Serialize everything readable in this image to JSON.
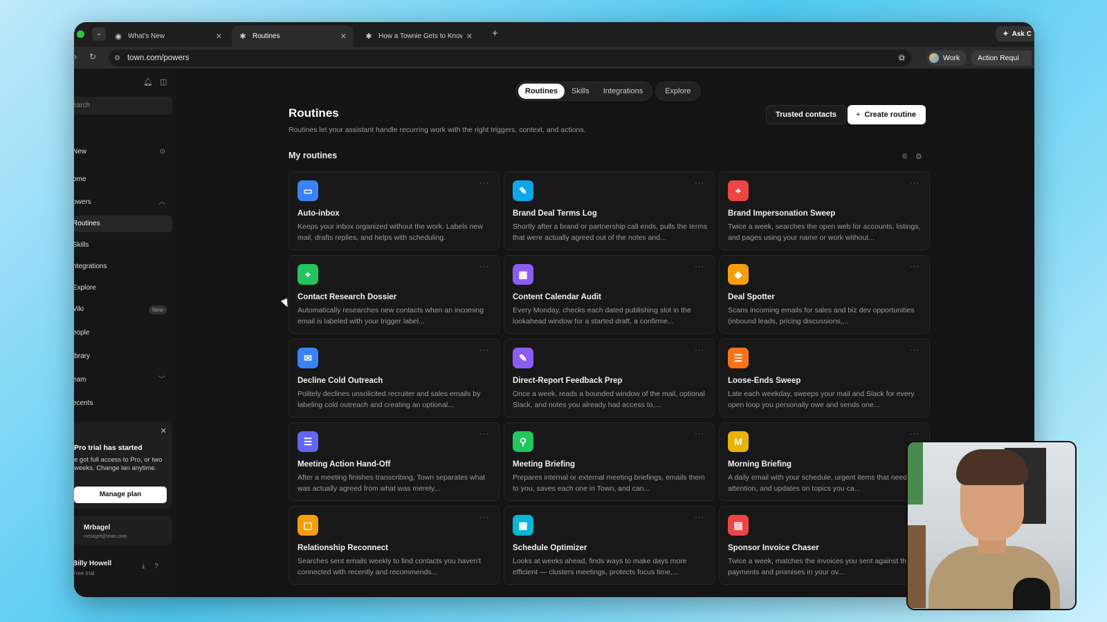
{
  "browser": {
    "tabs": [
      {
        "label": "What's New",
        "icon": "globe-icon"
      },
      {
        "label": "Routines",
        "icon": "asterisk-icon",
        "active": true
      },
      {
        "label": "How a Townie Gets to Know Y",
        "icon": "asterisk-icon"
      }
    ],
    "ask_label": "Ask C",
    "url": "town.com/powers",
    "profile_label": "Work",
    "action_label": "Action Requi"
  },
  "sidebar": {
    "search_placeholder": "earch",
    "items": [
      {
        "label": "New",
        "key": "new"
      },
      {
        "label": "ome",
        "key": "home"
      },
      {
        "label": "owers",
        "key": "powers"
      },
      {
        "label": "Routines",
        "key": "routines"
      },
      {
        "label": "Skills",
        "key": "skills"
      },
      {
        "label": "ntegrations",
        "key": "integrations"
      },
      {
        "label": "Explore",
        "key": "explore"
      },
      {
        "label": "Viki",
        "key": "wiki",
        "badge": "New"
      },
      {
        "label": "eople",
        "key": "people"
      },
      {
        "label": "ibrary",
        "key": "library"
      },
      {
        "label": "eam",
        "key": "team"
      },
      {
        "label": "ecents",
        "key": "recents"
      }
    ],
    "trial": {
      "title": "Pro trial has started",
      "body": "e got full access to Pro, or two weeks. Change lan anytime.",
      "button": "Manage plan"
    },
    "account": {
      "name": "Mrbagel",
      "email": "mrbagel@town.com"
    },
    "user": {
      "name": "Billy Howell",
      "status": "Free trial"
    }
  },
  "main": {
    "tabs": [
      "Routines",
      "Skills",
      "Integrations",
      "Explore"
    ],
    "title": "Routines",
    "subtitle": "Routines let your assistant handle recurring work with the right triggers, context, and actions.",
    "trusted_label": "Trusted contacts",
    "create_label": "Create routine",
    "section_title": "My routines",
    "cards": [
      {
        "title": "Auto-inbox",
        "desc": "Keeps your inbox organized without the work. Labels new mail, drafts replies, and helps with scheduling.",
        "color": "#3b82f6",
        "icon": "inbox-icon",
        "glyph": "▭"
      },
      {
        "title": "Brand Deal Terms Log",
        "desc": "Shortly after a brand or partnership call ends, pulls the terms that were actually agreed out of the notes and...",
        "color": "#0ea5e9",
        "icon": "pen-icon",
        "glyph": "✎"
      },
      {
        "title": "Brand Impersonation Sweep",
        "desc": "Twice a week, searches the open web for accounts, listings, and pages using your name or work without...",
        "color": "#ef4444",
        "icon": "scan-icon",
        "glyph": "⌖"
      },
      {
        "title": "Contact Research Dossier",
        "desc": "Automatically researches new contacts when an incoming email is labeled with your trigger label...",
        "color": "#22c55e",
        "icon": "contact-scan-icon",
        "glyph": "⌖"
      },
      {
        "title": "Content Calendar Audit",
        "desc": "Every Monday, checks each dated publishing slot in the lookahead window for a started draft, a confirme...",
        "color": "#8b5cf6",
        "icon": "calendar-icon",
        "glyph": "▦"
      },
      {
        "title": "Deal Spotter",
        "desc": "Scans incoming emails for sales and biz dev opportunities (inbound leads, pricing discussions,...",
        "color": "#f59e0b",
        "icon": "handshake-icon",
        "glyph": "◆"
      },
      {
        "title": "Decline Cold Outreach",
        "desc": "Politely declines unsolicited recruiter and sales emails by labeling cold outreach and creating an optional...",
        "color": "#3b82f6",
        "icon": "mail-icon",
        "glyph": "✉"
      },
      {
        "title": "Direct-Report Feedback Prep",
        "desc": "Once a week, reads a bounded window of the mail, optional Slack, and notes you already had access to,...",
        "color": "#8b5cf6",
        "icon": "pen-icon",
        "glyph": "✎"
      },
      {
        "title": "Loose-Ends Sweep",
        "desc": "Late each weekday, sweeps your mail and Slack for every open loop you personally owe and sends one...",
        "color": "#f97316",
        "icon": "checklist-icon",
        "glyph": "☰"
      },
      {
        "title": "Meeting Action Hand-Off",
        "desc": "After a meeting finishes transcribing, Town separates what was actually agreed from what was merely...",
        "color": "#6366f1",
        "icon": "list-icon",
        "glyph": "☰"
      },
      {
        "title": "Meeting Briefing",
        "desc": "Prepares internal or external meeting briefings, emails them to you, saves each one in Town, and can...",
        "color": "#22c55e",
        "icon": "search-icon",
        "glyph": "⚲"
      },
      {
        "title": "Morning Briefing",
        "desc": "A daily email with your schedule, urgent items that need attention, and updates on topics you ca...",
        "color": "#eab308",
        "icon": "letter-m-icon",
        "glyph": "M"
      },
      {
        "title": "Relationship Reconnect",
        "desc": "Searches sent emails weekly to find contacts you haven't connected with recently and recommends...",
        "color": "#f59e0b",
        "icon": "chat-icon",
        "glyph": "▢"
      },
      {
        "title": "Schedule Optimizer",
        "desc": "Looks at weeks ahead, finds ways to make days more efficient — clusters meetings, protects focus time,...",
        "color": "#06b6d4",
        "icon": "calendar-icon",
        "glyph": "▦"
      },
      {
        "title": "Sponsor Invoice Chaser",
        "desc": "Twice a week, matches the invoices you sent against the payments and promises in your ov...",
        "color": "#ef4444",
        "icon": "invoice-icon",
        "glyph": "▤"
      }
    ]
  }
}
